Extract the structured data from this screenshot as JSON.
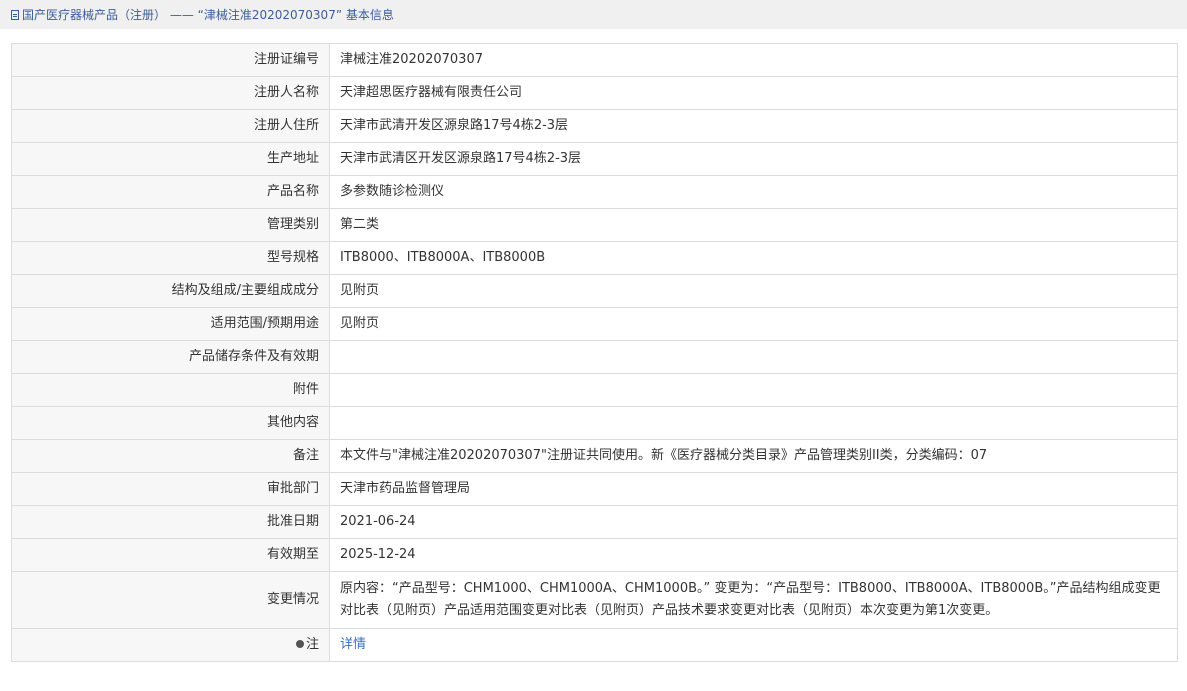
{
  "header": {
    "breadcrumb": "国产医疗器械产品（注册） —— “津械注准20202070307” 基本信息"
  },
  "rows": [
    {
      "label": "注册证编号",
      "value": "津械注准20202070307"
    },
    {
      "label": "注册人名称",
      "value": "天津超思医疗器械有限责任公司"
    },
    {
      "label": "注册人住所",
      "value": "天津市武清开发区源泉路17号4栋2-3层"
    },
    {
      "label": "生产地址",
      "value": "天津市武清区开发区源泉路17号4栋2-3层"
    },
    {
      "label": "产品名称",
      "value": "多参数随诊检测仪"
    },
    {
      "label": "管理类别",
      "value": "第二类"
    },
    {
      "label": "型号规格",
      "value": "ITB8000、ITB8000A、ITB8000B"
    },
    {
      "label": "结构及组成/主要组成成分",
      "value": "见附页"
    },
    {
      "label": "适用范围/预期用途",
      "value": "见附页"
    },
    {
      "label": "产品储存条件及有效期",
      "value": ""
    },
    {
      "label": "附件",
      "value": ""
    },
    {
      "label": "其他内容",
      "value": ""
    },
    {
      "label": "备注",
      "value": "本文件与\"津械注准20202070307\"注册证共同使用。新《医疗器械分类目录》产品管理类别II类，分类编码：07"
    },
    {
      "label": "审批部门",
      "value": "天津市药品监督管理局"
    },
    {
      "label": "批准日期",
      "value": "2021-06-24"
    },
    {
      "label": "有效期至",
      "value": "2025-12-24"
    },
    {
      "label": "变更情况",
      "value": "原内容：“产品型号：CHM1000、CHM1000A、CHM1000B。” 变更为：“产品型号：ITB8000、ITB8000A、ITB8000B。”产品结构组成变更对比表（见附页）产品适用范围变更对比表（见附页）产品技术要求变更对比表（见附页）本次变更为第1次变更。"
    }
  ],
  "note": {
    "label": "注",
    "icon": "bulb-icon",
    "link_text": "详情",
    "link_color": "#3a6fc5"
  }
}
